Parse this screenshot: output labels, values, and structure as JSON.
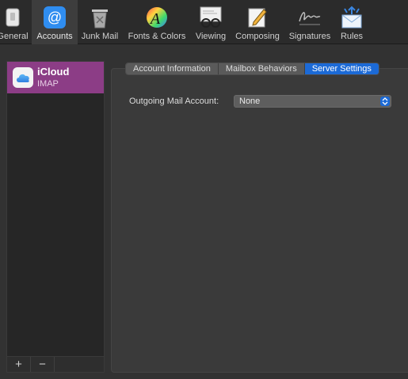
{
  "toolbar": {
    "items": [
      {
        "label": "General",
        "icon": "general-switch-icon"
      },
      {
        "label": "Accounts",
        "icon": "at-sign-icon"
      },
      {
        "label": "Junk Mail",
        "icon": "trash-can-icon"
      },
      {
        "label": "Fonts & Colors",
        "icon": "color-wheel-icon"
      },
      {
        "label": "Viewing",
        "icon": "glasses-icon"
      },
      {
        "label": "Composing",
        "icon": "pencil-page-icon"
      },
      {
        "label": "Signatures",
        "icon": "signature-icon"
      },
      {
        "label": "Rules",
        "icon": "envelope-arrows-icon"
      }
    ],
    "active": "Accounts"
  },
  "accounts": {
    "items": [
      {
        "name": "iCloud",
        "type": "IMAP",
        "icon": "icloud-icon"
      }
    ],
    "add_label": "+",
    "remove_label": "−"
  },
  "tabs": {
    "items": [
      {
        "label": "Account Information"
      },
      {
        "label": "Mailbox Behaviors"
      },
      {
        "label": "Server Settings"
      }
    ],
    "active": "Server Settings"
  },
  "server_settings": {
    "outgoing_label": "Outgoing Mail Account:",
    "outgoing_value": "None"
  },
  "colors": {
    "accent": "#1c6ad6",
    "selected_account": "#8c3d86",
    "background": "#323232"
  }
}
